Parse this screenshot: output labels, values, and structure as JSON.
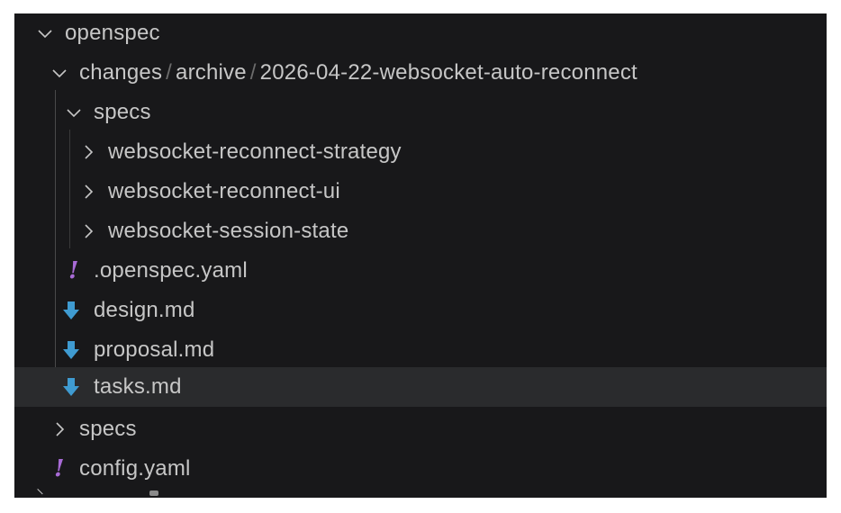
{
  "tree": {
    "root": {
      "label": "openspec",
      "twisty": "chevron-down-icon"
    },
    "changes_path": {
      "segments": [
        "changes",
        "archive",
        "2026-04-22-websocket-auto-reconnect"
      ],
      "separator": "/",
      "twisty": "chevron-down-icon"
    },
    "specs_folder": {
      "label": "specs",
      "twisty": "chevron-down-icon"
    },
    "spec_items": [
      {
        "label": "websocket-reconnect-strategy",
        "twisty": "chevron-right-icon"
      },
      {
        "label": "websocket-reconnect-ui",
        "twisty": "chevron-right-icon"
      },
      {
        "label": "websocket-session-state",
        "twisty": "chevron-right-icon"
      }
    ],
    "files": [
      {
        "label": ".openspec.yaml",
        "icon": "yaml-exclamation-icon",
        "icon_glyph": "!"
      },
      {
        "label": "design.md",
        "icon": "markdown-arrow-icon"
      },
      {
        "label": "proposal.md",
        "icon": "markdown-arrow-icon"
      },
      {
        "label": "tasks.md",
        "icon": "markdown-arrow-icon",
        "selected": true
      }
    ],
    "specs_top": {
      "label": "specs",
      "twisty": "chevron-right-icon"
    },
    "config": {
      "label": "config.yaml",
      "icon": "yaml-exclamation-icon",
      "icon_glyph": "!"
    }
  },
  "colors": {
    "background": "#18181a",
    "selected_row": "#2a2b2d",
    "text": "#c6c6c6",
    "yaml_icon": "#a86bd6",
    "markdown_icon": "#3f9bd1"
  }
}
